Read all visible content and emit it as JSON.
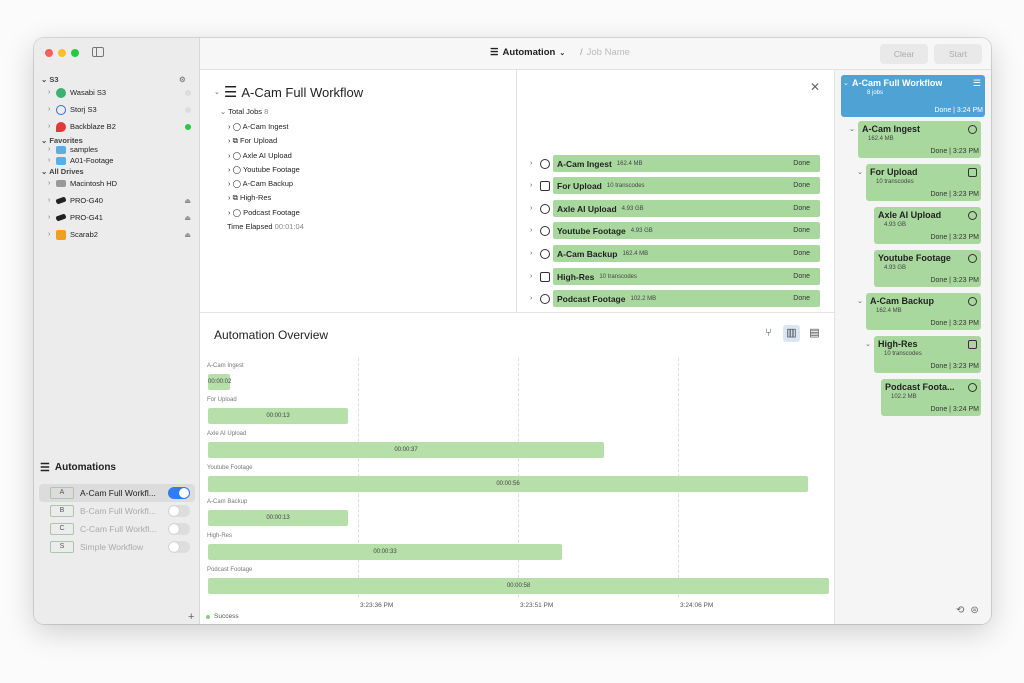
{
  "colors": {
    "accent": "#2f7cf6",
    "done": "#a9d89e",
    "selected_card": "#4ea3d4",
    "success": "#8bd07a"
  },
  "sidebar": {
    "s3_header": "S3",
    "s3": [
      {
        "label": "Wasabi S3",
        "status": "none"
      },
      {
        "label": "Storj S3",
        "status": "none"
      },
      {
        "label": "Backblaze B2",
        "status": "online"
      }
    ],
    "favorites_header": "Favorites",
    "favorites": [
      {
        "label": "samples"
      },
      {
        "label": "A01-Footage"
      }
    ],
    "drives_header": "All Drives",
    "drives": [
      {
        "label": "Macintosh HD"
      },
      {
        "label": "PRO-G40"
      },
      {
        "label": "PRO-G41"
      },
      {
        "label": "Scarab2"
      }
    ],
    "automations_title": "Automations",
    "automations": [
      {
        "badge": "A",
        "label": "A-Cam Full Workfl...",
        "enabled": true
      },
      {
        "badge": "B",
        "label": "B-Cam Full Workfl...",
        "enabled": false
      },
      {
        "badge": "C",
        "label": "C-Cam Full Workfl...",
        "enabled": false
      },
      {
        "badge": "S",
        "label": "Simple Workflow",
        "enabled": false
      }
    ]
  },
  "toolbar": {
    "mode": "Automation",
    "job_placeholder": "Job Name",
    "clear": "Clear",
    "start": "Start"
  },
  "workflow": {
    "title": "A-Cam Full Workflow",
    "total_jobs_label": "Total Jobs",
    "total_jobs": "8",
    "tree": [
      "A-Cam Ingest",
      "For Upload",
      "Axle AI Upload",
      "Youtube Footage",
      "A-Cam Backup",
      "High-Res",
      "Podcast Footage"
    ],
    "elapsed_label": "Time Elapsed",
    "elapsed": "00:01:04",
    "steps": [
      {
        "name": "A-Cam Ingest",
        "size": "162.4 MB",
        "status": "Done"
      },
      {
        "name": "For Upload",
        "size": "10 transcodes",
        "status": "Done"
      },
      {
        "name": "Axle AI Upload",
        "size": "4.93 GB",
        "status": "Done"
      },
      {
        "name": "Youtube Footage",
        "size": "4.93 GB",
        "status": "Done"
      },
      {
        "name": "A-Cam Backup",
        "size": "162.4 MB",
        "status": "Done"
      },
      {
        "name": "High-Res",
        "size": "10 transcodes",
        "status": "Done"
      },
      {
        "name": "Podcast Footage",
        "size": "102.2 MB",
        "status": "Done"
      }
    ]
  },
  "overview": {
    "title": "Automation Overview",
    "rows": [
      {
        "label": "A-Cam Ingest",
        "duration": "00:00:02"
      },
      {
        "label": "For Upload",
        "duration": "00:00:13"
      },
      {
        "label": "Axle AI Upload",
        "duration": "00:00:37"
      },
      {
        "label": "Youtube Footage",
        "duration": "00:00:56"
      },
      {
        "label": "A-Cam Backup",
        "duration": "00:00:13"
      },
      {
        "label": "High-Res",
        "duration": "00:00:33"
      },
      {
        "label": "Podcast Footage",
        "duration": "00:00:58"
      }
    ],
    "ticks": [
      "3:23:36 PM",
      "3:23:51 PM",
      "3:24:06 PM"
    ],
    "legend": "Success"
  },
  "history": {
    "root": {
      "title": "A-Cam Full Workflow",
      "sub": "8 jobs",
      "done": "Done | 3:24 PM"
    },
    "cards": [
      {
        "title": "A-Cam Ingest",
        "sub": "162.4 MB",
        "done": "Done | 3:23 PM"
      },
      {
        "title": "For Upload",
        "sub": "10 transcodes",
        "done": "Done | 3:23 PM"
      },
      {
        "title": "Axle AI Upload",
        "sub": "4.93 GB",
        "done": "Done | 3:23 PM"
      },
      {
        "title": "Youtube Footage",
        "sub": "4.93 GB",
        "done": "Done | 3:23 PM"
      },
      {
        "title": "A-Cam Backup",
        "sub": "162.4 MB",
        "done": "Done | 3:23 PM"
      },
      {
        "title": "High-Res",
        "sub": "10 transcodes",
        "done": "Done | 3:23 PM"
      },
      {
        "title": "Podcast Foota...",
        "sub": "102.2 MB",
        "done": "Done | 3:24 PM"
      }
    ]
  }
}
